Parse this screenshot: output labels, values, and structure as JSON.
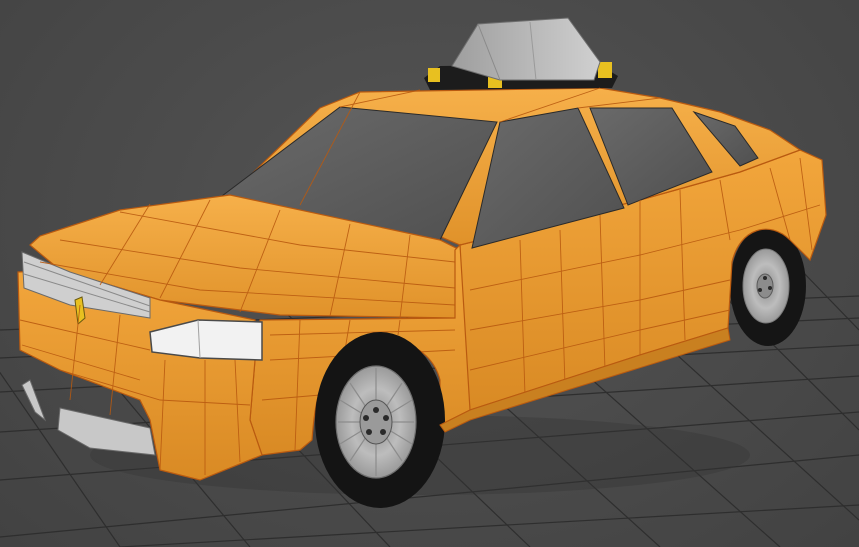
{
  "viewport": {
    "background": "#4a4a4a",
    "grid_color": "#2f2f2f",
    "view_mode": "perspective",
    "shading": "shaded-with-wireframe",
    "visible_labels": []
  },
  "scene": {
    "model": "taxi-car",
    "body_color": "#f0a436",
    "wire_color": "#b95a10",
    "glass_color": "#5e5e5e",
    "roof_sign_color": "#bdbdbd",
    "roof_sign_base_color": "#1c1c1c",
    "roof_sign_lamp_color": "#e8c020",
    "headlight_color": "#f2f2f2",
    "tire_color": "#141414",
    "rim_color": "#b3b3b3"
  }
}
